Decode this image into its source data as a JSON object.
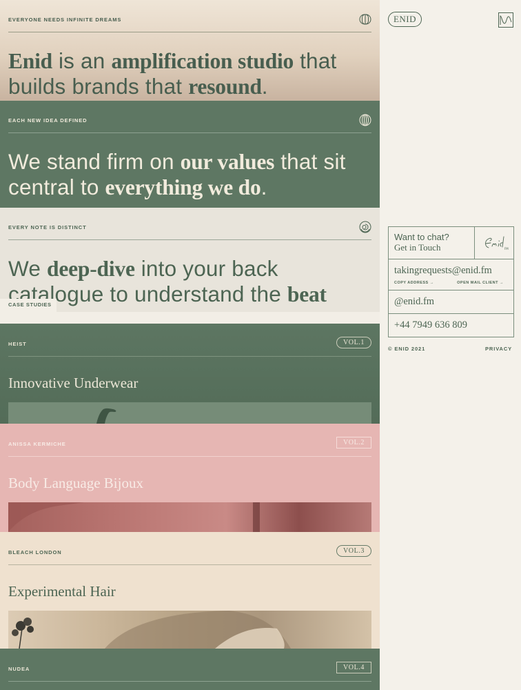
{
  "panels": [
    {
      "eyebrow": "EVERYONE NEEDS INFINITE DREAMS",
      "icon": "rings-icon",
      "line1": [
        {
          "t": "Enid",
          "b": true
        },
        {
          "t": " is an ",
          "b": false
        },
        {
          "t": "amplification studio",
          "b": true
        },
        {
          "t": " that",
          "b": false
        }
      ],
      "line2": [
        {
          "t": "builds brands that ",
          "b": false
        },
        {
          "t": "resound",
          "b": true
        },
        {
          "t": ".",
          "b": false
        }
      ]
    },
    {
      "eyebrow": "EACH NEW IDEA DEFINED",
      "icon": "striped-globe-icon",
      "line1": [
        {
          "t": "We stand firm on ",
          "b": false
        },
        {
          "t": "our values",
          "b": true
        },
        {
          "t": " that sit",
          "b": false
        }
      ],
      "line2": [
        {
          "t": "central to ",
          "b": false
        },
        {
          "t": "everything we do",
          "b": true
        },
        {
          "t": ".",
          "b": false
        }
      ]
    },
    {
      "eyebrow": "EVERY NOTE IS DISTINCT",
      "icon": "spiral-icon",
      "line1": [
        {
          "t": "We ",
          "b": false
        },
        {
          "t": "deep-dive",
          "b": true
        },
        {
          "t": " into your back",
          "b": false
        }
      ],
      "line2": [
        {
          "t": "catalogue to understand the ",
          "b": false
        },
        {
          "t": "beat",
          "b": true
        }
      ]
    }
  ],
  "case_studies": {
    "tab_label": "CASE STUDIES",
    "items": [
      {
        "client": "HEIST",
        "vol": "VOL.1",
        "title": "Innovative Underwear"
      },
      {
        "client": "ANISSA KERMICHE",
        "vol": "VOL.2",
        "title": "Body Language Bijoux"
      },
      {
        "client": "BLEACH LONDON",
        "vol": "VOL.3",
        "title": "Experimental Hair"
      },
      {
        "client": "NUDEA",
        "vol": "VOL.4",
        "title": ""
      }
    ]
  },
  "header": {
    "logo": "ENID",
    "menu_icon": "waveform-menu-icon"
  },
  "contact": {
    "chat_line1": "Want to chat?",
    "chat_line2": "Get in Touch",
    "signature": "Enid",
    "email": "takingrequests@enid.fm",
    "copy_address": "COPY ADDRESS →",
    "open_mail": "OPEN MAIL CLIENT →",
    "handle": "@enid.fm",
    "phone": "+44 7949 636 809"
  },
  "footer": {
    "copyright": "© ENID 2021",
    "privacy": "PRIVACY"
  },
  "colors": {
    "green": "#5e7763",
    "pink": "#e6b6b3",
    "cream": "#f4f1ea",
    "ink": "#4d6553"
  }
}
